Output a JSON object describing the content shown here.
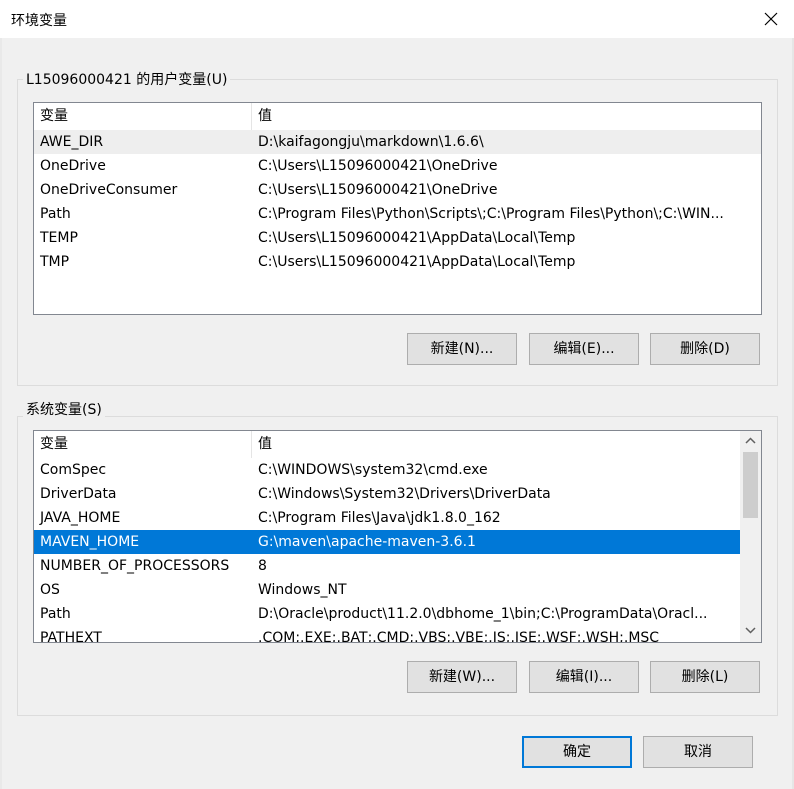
{
  "window": {
    "title": "环境变量",
    "close_icon": "close-icon"
  },
  "user_vars": {
    "group_label": "L15096000421 的用户变量(U)",
    "columns": [
      "变量",
      "值"
    ],
    "rows": [
      [
        "AWE_DIR",
        "D:\\kaifagongju\\markdown\\1.6.6\\"
      ],
      [
        "OneDrive",
        "C:\\Users\\L15096000421\\OneDrive"
      ],
      [
        "OneDriveConsumer",
        "C:\\Users\\L15096000421\\OneDrive"
      ],
      [
        "Path",
        "C:\\Program Files\\Python\\Scripts\\;C:\\Program Files\\Python\\;C:\\WIN..."
      ],
      [
        "TEMP",
        "C:\\Users\\L15096000421\\AppData\\Local\\Temp"
      ],
      [
        "TMP",
        "C:\\Users\\L15096000421\\AppData\\Local\\Temp"
      ]
    ],
    "buttons": {
      "new": "新建(N)...",
      "edit": "编辑(E)...",
      "delete": "删除(D)"
    }
  },
  "system_vars": {
    "group_label": "系统变量(S)",
    "columns": [
      "变量",
      "值"
    ],
    "rows": [
      [
        "ComSpec",
        "C:\\WINDOWS\\system32\\cmd.exe"
      ],
      [
        "DriverData",
        "C:\\Windows\\System32\\Drivers\\DriverData"
      ],
      [
        "JAVA_HOME",
        "C:\\Program Files\\Java\\jdk1.8.0_162"
      ],
      [
        "MAVEN_HOME",
        "G:\\maven\\apache-maven-3.6.1"
      ],
      [
        "NUMBER_OF_PROCESSORS",
        "8"
      ],
      [
        "OS",
        "Windows_NT"
      ],
      [
        "Path",
        "D:\\Oracle\\product\\11.2.0\\dbhome_1\\bin;C:\\ProgramData\\Oracl..."
      ],
      [
        "PATHEXT",
        ".COM;.EXE;.BAT;.CMD;.VBS;.VBE;.JS;.JSE;.WSF;.WSH;.MSC"
      ]
    ],
    "selected_row": "MAVEN_HOME",
    "buttons": {
      "new": "新建(W)...",
      "edit": "编辑(I)...",
      "delete": "删除(L)"
    }
  },
  "footer": {
    "ok": "确定",
    "cancel": "取消"
  },
  "colors": {
    "selection": "#0078d7",
    "primary_border": "#0078d7"
  }
}
